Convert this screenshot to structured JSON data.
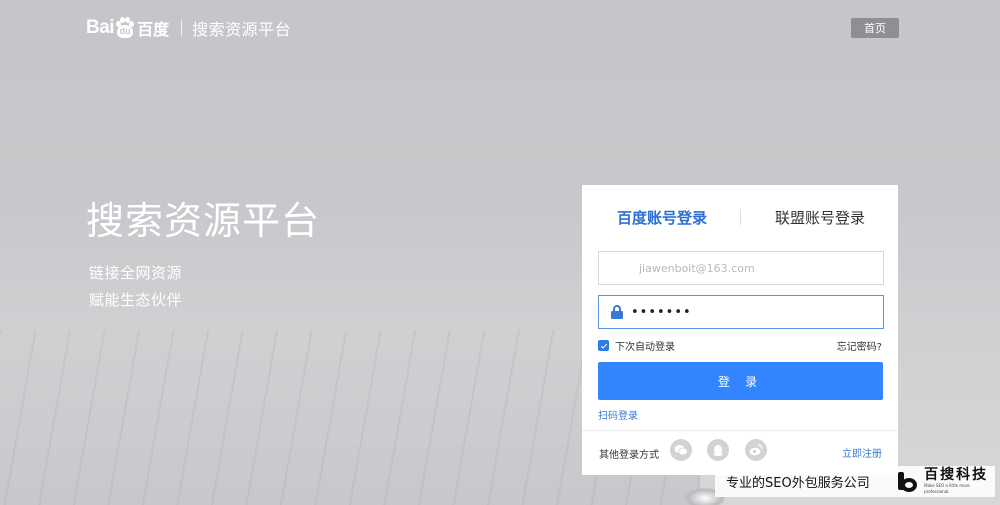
{
  "header": {
    "logo_text": "Bai",
    "logo_paw_text": "du",
    "logo_cn": "百度",
    "platform": "搜索资源平台",
    "home_label": "首页"
  },
  "hero": {
    "title": "搜索资源平台",
    "line1": "链接全网资源",
    "line2": "赋能生态伙伴"
  },
  "login": {
    "tab_baidu": "百度账号登录",
    "tab_union": "联盟账号登录",
    "username_value": "jiawenboit@163.com",
    "password_value": "•••••••",
    "remember_label": "下次自动登录",
    "remember_checked": true,
    "forgot_label": "忘记密码?",
    "submit_label": "登 录",
    "qr_login_label": "扫码登录",
    "other_methods_label": "其他登录方式",
    "register_label": "立即注册",
    "social_icons": [
      "wechat-icon",
      "qq-icon",
      "weibo-icon"
    ],
    "accent_color": "#3385ff"
  },
  "watermark": {
    "text": "专业的SEO外包服务公司",
    "brand": "百搜科技",
    "slogan": "Make SEO a little more professional."
  }
}
